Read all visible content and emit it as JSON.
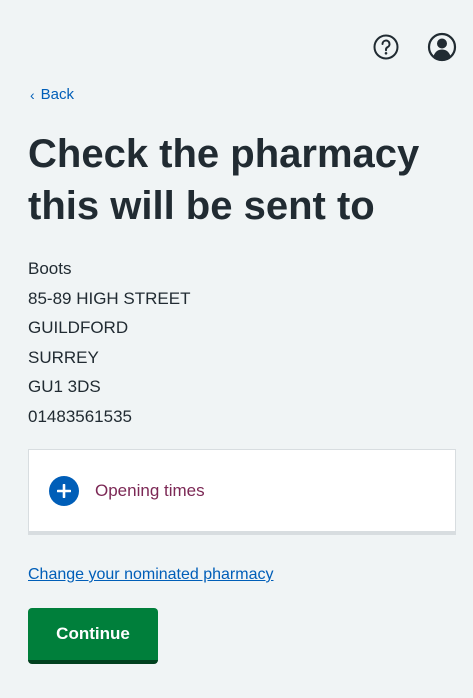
{
  "header": {
    "help_icon": "help-circle-icon",
    "account_icon": "account-circle-icon"
  },
  "back_link": {
    "label": "Back"
  },
  "page_title": "Check the pharmacy this will be sent to",
  "pharmacy": {
    "name": "Boots",
    "address_line1": "85-89 HIGH STREET",
    "town": "GUILDFORD",
    "county": "SURREY",
    "postcode": "GU1 3DS",
    "phone": "01483561535"
  },
  "opening_times": {
    "label": "Opening times"
  },
  "change_link": {
    "label": "Change your nominated pharmacy"
  },
  "continue_button": {
    "label": "Continue"
  },
  "colors": {
    "background": "#f0f4f5",
    "link": "#005eb8",
    "button": "#007f3b",
    "details_text": "#7c2855"
  }
}
